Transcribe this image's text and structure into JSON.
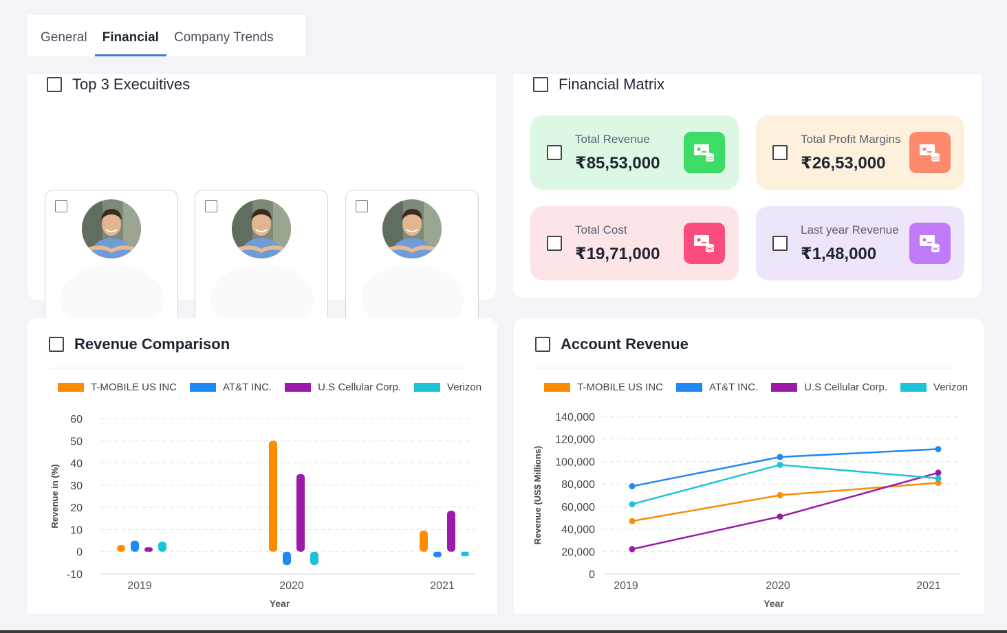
{
  "tabs": [
    {
      "label": "General",
      "active": false
    },
    {
      "label": "Financial",
      "active": true
    },
    {
      "label": "Company Trends",
      "active": false
    }
  ],
  "executives": {
    "title": "Top 3 Execuitives",
    "cards": [
      {
        "avatar": "avatar-photo"
      },
      {
        "avatar": "avatar-photo"
      },
      {
        "avatar": "avatar-photo"
      }
    ]
  },
  "financial_matrix": {
    "title": "Financial Matrix",
    "metrics": [
      {
        "label": "Total Revenue",
        "value": "₹85,53,000",
        "bg": "#dcf8e4",
        "icon_color": "#3ddc66",
        "icon": "money-icon"
      },
      {
        "label": "Total Profit Margins",
        "value": "₹26,53,000",
        "bg": "#fdf0dd",
        "icon_color": "#fd8a6c",
        "icon": "money-icon"
      },
      {
        "label": "Total Cost",
        "value": "₹19,71,000",
        "bg": "#fde4e7",
        "icon_color": "#fa4d7e",
        "icon": "money-icon"
      },
      {
        "label": "Last year Revenue",
        "value": "₹1,48,000",
        "bg": "#efe5fb",
        "icon_color": "#c07af7",
        "icon": "money-icon"
      }
    ]
  },
  "revenue_comparison": {
    "title": "Revenue Comparison"
  },
  "account_revenue": {
    "title": "Account Revenue"
  },
  "colors": {
    "tmobile": "#fb8c00",
    "att": "#1e88f5",
    "uscellular": "#9c1aa9",
    "verizon": "#1cc3d6"
  },
  "chart_data": [
    {
      "type": "bar",
      "title": "",
      "xlabel": "Year",
      "ylabel": "Revenue in (%)",
      "categories": [
        "2019",
        "2020",
        "2021"
      ],
      "ylim": [
        -10,
        60
      ],
      "yticks": [
        "60",
        "50",
        "40",
        "30",
        "20",
        "10",
        "0",
        "-10"
      ],
      "grid": true,
      "legend_position": "top",
      "series": [
        {
          "name": "T-MOBILE US INC",
          "values": [
            3,
            50,
            9.5
          ]
        },
        {
          "name": "AT&T INC.",
          "values": [
            5,
            -6,
            -2.5
          ]
        },
        {
          "name": "U.S Cellular Corp.",
          "values": [
            2,
            35,
            18.5
          ]
        },
        {
          "name": "Verizon",
          "values": [
            4.5,
            -6,
            -2
          ]
        }
      ]
    },
    {
      "type": "line",
      "title": "",
      "xlabel": "Year",
      "ylabel": "Revenue (US$ Millions)",
      "x": [
        "2019",
        "2020",
        "2021"
      ],
      "ylim": [
        0,
        140000
      ],
      "yticks": [
        "140,000",
        "120,000",
        "100,000",
        "80,000",
        "60,000",
        "40,000",
        "20,000",
        "0"
      ],
      "grid": true,
      "legend_position": "top",
      "series": [
        {
          "name": "T-MOBILE US INC",
          "values": [
            47000,
            70000,
            81000
          ]
        },
        {
          "name": "AT&T INC.",
          "values": [
            78000,
            104000,
            111000
          ]
        },
        {
          "name": "U.S Cellular Corp.",
          "values": [
            22000,
            51000,
            90000
          ]
        },
        {
          "name": "Verizon",
          "values": [
            62000,
            97000,
            85000
          ]
        }
      ]
    }
  ]
}
